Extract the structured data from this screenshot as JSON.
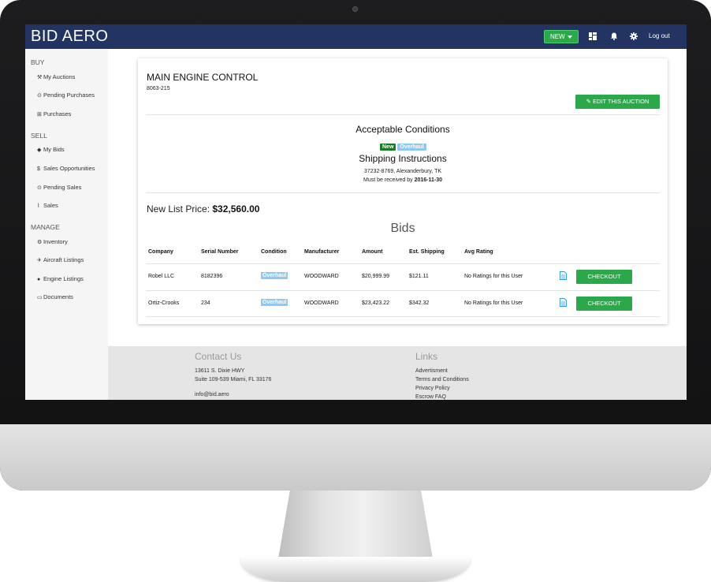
{
  "app": {
    "brand": "BID AERO"
  },
  "navbar": {
    "new_label": "NEW",
    "logout_label": "Log out"
  },
  "sidebar": {
    "sections": [
      {
        "label": "BUY",
        "items": [
          "My Auctions",
          "Pending Purchases",
          "Purchases"
        ]
      },
      {
        "label": "SELL",
        "items": [
          "My Bids",
          "Sales Opportunities",
          "Pending Sales",
          "Sales"
        ]
      },
      {
        "label": "MANAGE",
        "items": [
          "Inventory",
          "Aircraft Listings",
          "Engine Listings",
          "Documents"
        ]
      }
    ]
  },
  "auction": {
    "title": "MAIN ENGINE CONTROL",
    "part_number": "8063-215",
    "edit_label": "EDIT THIS AUCTION",
    "conditions_heading": "Acceptable Conditions",
    "conditions": [
      "New",
      "Overhaul"
    ],
    "shipping_heading": "Shipping Instructions",
    "shipping_address": "37232-8769, Alexanderbury, TK",
    "received_by_prefix": "Must be received by",
    "received_by_date": "2016-11-30",
    "price_label": "New List Price:",
    "price_value": "$32,560.00"
  },
  "bids": {
    "heading": "Bids",
    "columns": [
      "Company",
      "Serial Number",
      "Condition",
      "Manufacturer",
      "Amount",
      "Est. Shipping",
      "Avg Rating"
    ],
    "rows": [
      {
        "company": "Robel LLC",
        "serial": "8182396",
        "condition": "Overhaul",
        "manufacturer": "WOODWARD",
        "amount": "$20,999.99",
        "shipping": "$121.11",
        "rating": "No Ratings for this User",
        "action": "CHECKOUT"
      },
      {
        "company": "Ortiz-Crooks",
        "serial": "234",
        "condition": "Overhaul",
        "manufacturer": "WOODWARD",
        "amount": "$23,423.22",
        "shipping": "$342.32",
        "rating": "No Ratings for this User",
        "action": "CHECKOUT"
      }
    ]
  },
  "footer": {
    "contact_heading": "Contact Us",
    "address_line1": "13611 S. Dixie HWY",
    "address_line2": "Suite 109-539 Miami, FL 33176",
    "email": "info@bid.aero",
    "links_heading": "Links",
    "links": [
      "Advertisment",
      "Terms and Conditions",
      "Privacy Policy",
      "Escrow FAQ"
    ]
  },
  "colors": {
    "navbar": "#233463",
    "accent_green": "#2ba84a",
    "badge_new": "#1a7d25",
    "badge_overhaul": "#8fc9f2"
  }
}
